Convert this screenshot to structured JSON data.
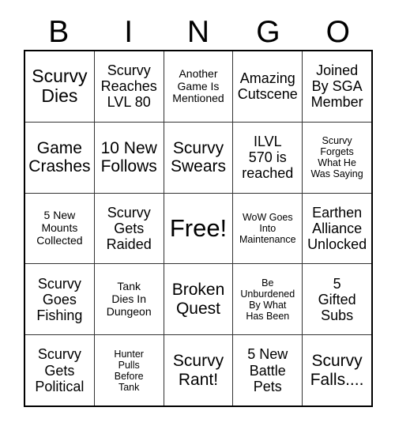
{
  "card": {
    "header_letters": [
      "B",
      "I",
      "N",
      "G",
      "O"
    ],
    "rows": [
      [
        {
          "text": "Scurvy\nDies",
          "size": "xl"
        },
        {
          "text": "Scurvy\nReaches\nLVL 80",
          "size": "md"
        },
        {
          "text": "Another\nGame Is\nMentioned",
          "size": "sm"
        },
        {
          "text": "Amazing\nCutscene",
          "size": "md"
        },
        {
          "text": "Joined\nBy SGA\nMember",
          "size": "md"
        }
      ],
      [
        {
          "text": "Game\nCrashes",
          "size": "lg"
        },
        {
          "text": "10 New\nFollows",
          "size": "lg"
        },
        {
          "text": "Scurvy\nSwears",
          "size": "lg"
        },
        {
          "text": "ILVL\n570 is\nreached",
          "size": "md"
        },
        {
          "text": "Scurvy\nForgets\nWhat He\nWas Saying",
          "size": "xs"
        }
      ],
      [
        {
          "text": "5 New\nMounts\nCollected",
          "size": "sm"
        },
        {
          "text": "Scurvy\nGets\nRaided",
          "size": "md"
        },
        {
          "text": "Free!",
          "size": "xxl"
        },
        {
          "text": "WoW Goes\nInto\nMaintenance",
          "size": "xs"
        },
        {
          "text": "Earthen\nAlliance\nUnlocked",
          "size": "md"
        }
      ],
      [
        {
          "text": "Scurvy\nGoes\nFishing",
          "size": "md"
        },
        {
          "text": "Tank\nDies In\nDungeon",
          "size": "sm"
        },
        {
          "text": "Broken\nQuest",
          "size": "lg"
        },
        {
          "text": "Be\nUnburdened\nBy What\nHas Been",
          "size": "xs"
        },
        {
          "text": "5\nGifted\nSubs",
          "size": "md"
        }
      ],
      [
        {
          "text": "Scurvy\nGets\nPolitical",
          "size": "md"
        },
        {
          "text": "Hunter\nPulls\nBefore\nTank",
          "size": "xs"
        },
        {
          "text": "Scurvy\nRant!",
          "size": "lg"
        },
        {
          "text": "5 New\nBattle\nPets",
          "size": "md"
        },
        {
          "text": "Scurvy\nFalls....",
          "size": "lg"
        }
      ]
    ]
  }
}
